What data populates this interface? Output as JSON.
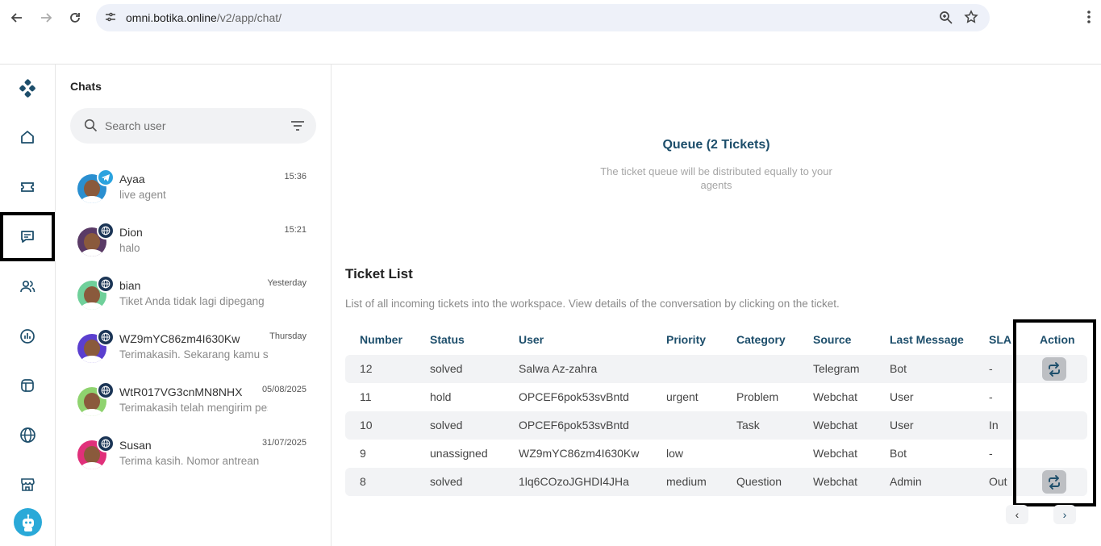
{
  "browser": {
    "url_host": "omni.botika.online",
    "url_path": "/v2/app/chat/"
  },
  "rail": {
    "items": [
      "logo-icon",
      "home-icon",
      "ticket-icon",
      "chat-icon",
      "contacts-icon",
      "report-icon",
      "widget-icon",
      "globe-icon",
      "store-icon"
    ]
  },
  "chats": {
    "title": "Chats",
    "search_placeholder": "Search user",
    "items": [
      {
        "name": "Ayaa",
        "time": "15:36",
        "message": "live agent",
        "channel": "telegram"
      },
      {
        "name": "Dion",
        "time": "15:21",
        "message": "halo",
        "channel": "web"
      },
      {
        "name": "bian",
        "time": "Yesterday",
        "message": "Tiket Anda tidak lagi dipegang",
        "channel": "web"
      },
      {
        "name": "WZ9mYC86zm4I630Kw",
        "time": "Thursday",
        "message": "Terimakasih. Sekarang kamu sudah",
        "channel": "web"
      },
      {
        "name": "WtR017VG3cnMN8NHX",
        "time": "05/08/2025",
        "message": "Terimakasih telah mengirim pesan",
        "channel": "web"
      },
      {
        "name": "Susan",
        "time": "31/07/2025",
        "message": "Terima kasih. Nomor antrean",
        "channel": "web"
      }
    ]
  },
  "queue": {
    "title": "Queue (2 Tickets)",
    "subtitle": "The ticket queue will be distributed equally to your agents"
  },
  "tickets": {
    "title": "Ticket List",
    "subtitle": "List of all incoming tickets into the workspace. View details of the conversation by clicking on the ticket.",
    "columns": [
      "Number",
      "Status",
      "User",
      "Priority",
      "Category",
      "Source",
      "Last Message",
      "SLA",
      "Action"
    ],
    "rows": [
      {
        "number": "12",
        "status": "solved",
        "user": "Salwa Az-zahra",
        "priority": "",
        "category": "",
        "source": "Telegram",
        "last_message": "Bot",
        "sla": "-",
        "action": true
      },
      {
        "number": "11",
        "status": "hold",
        "user": "OPCEF6pok53svBntd",
        "priority": "urgent",
        "category": "Problem",
        "source": "Webchat",
        "last_message": "User",
        "sla": "-",
        "action": false
      },
      {
        "number": "10",
        "status": "solved",
        "user": "OPCEF6pok53svBntd",
        "priority": "",
        "category": "Task",
        "source": "Webchat",
        "last_message": "User",
        "sla": "In",
        "action": false
      },
      {
        "number": "9",
        "status": "unassigned",
        "user": "WZ9mYC86zm4I630Kw",
        "priority": "low",
        "category": "",
        "source": "Webchat",
        "last_message": "Bot",
        "sla": "-",
        "action": false
      },
      {
        "number": "8",
        "status": "solved",
        "user": "1lq6COzoJGHDI4JHa",
        "priority": "medium",
        "category": "Question",
        "source": "Webchat",
        "last_message": "Admin",
        "sla": "Out",
        "action": true
      }
    ]
  },
  "pager": {
    "prev": "‹",
    "next": "›"
  },
  "colors": {
    "accent": "#1d4e6b",
    "telegram": "#2aa3df",
    "web_badge": "#1b3556",
    "highlight_border": "#000000"
  }
}
